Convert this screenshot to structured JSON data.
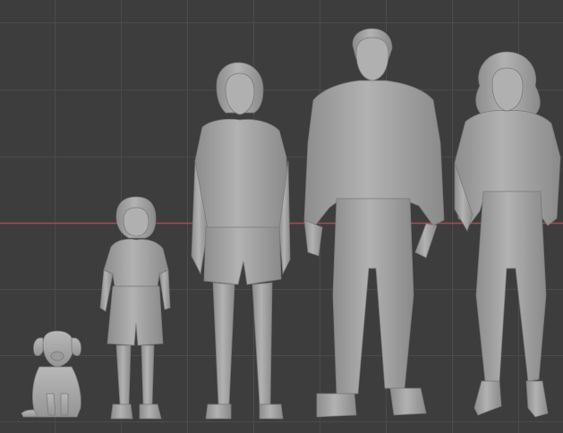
{
  "viewport": {
    "background": "#3d3d3d",
    "grid_color": "#4b4b4b",
    "x_axis_color": "#b5464b",
    "model_color": "#a9a9a9",
    "model_shade": "#7e7e7e",
    "model_highlight": "#c9c9c9"
  },
  "figures": [
    {
      "name": "dog",
      "kind": "sitting-dog"
    },
    {
      "name": "child",
      "kind": "child-shorts"
    },
    {
      "name": "teenage-girl",
      "kind": "cardigan-shorts"
    },
    {
      "name": "man",
      "kind": "jacket-pants"
    },
    {
      "name": "woman",
      "kind": "jacket-rolled-pants"
    }
  ]
}
